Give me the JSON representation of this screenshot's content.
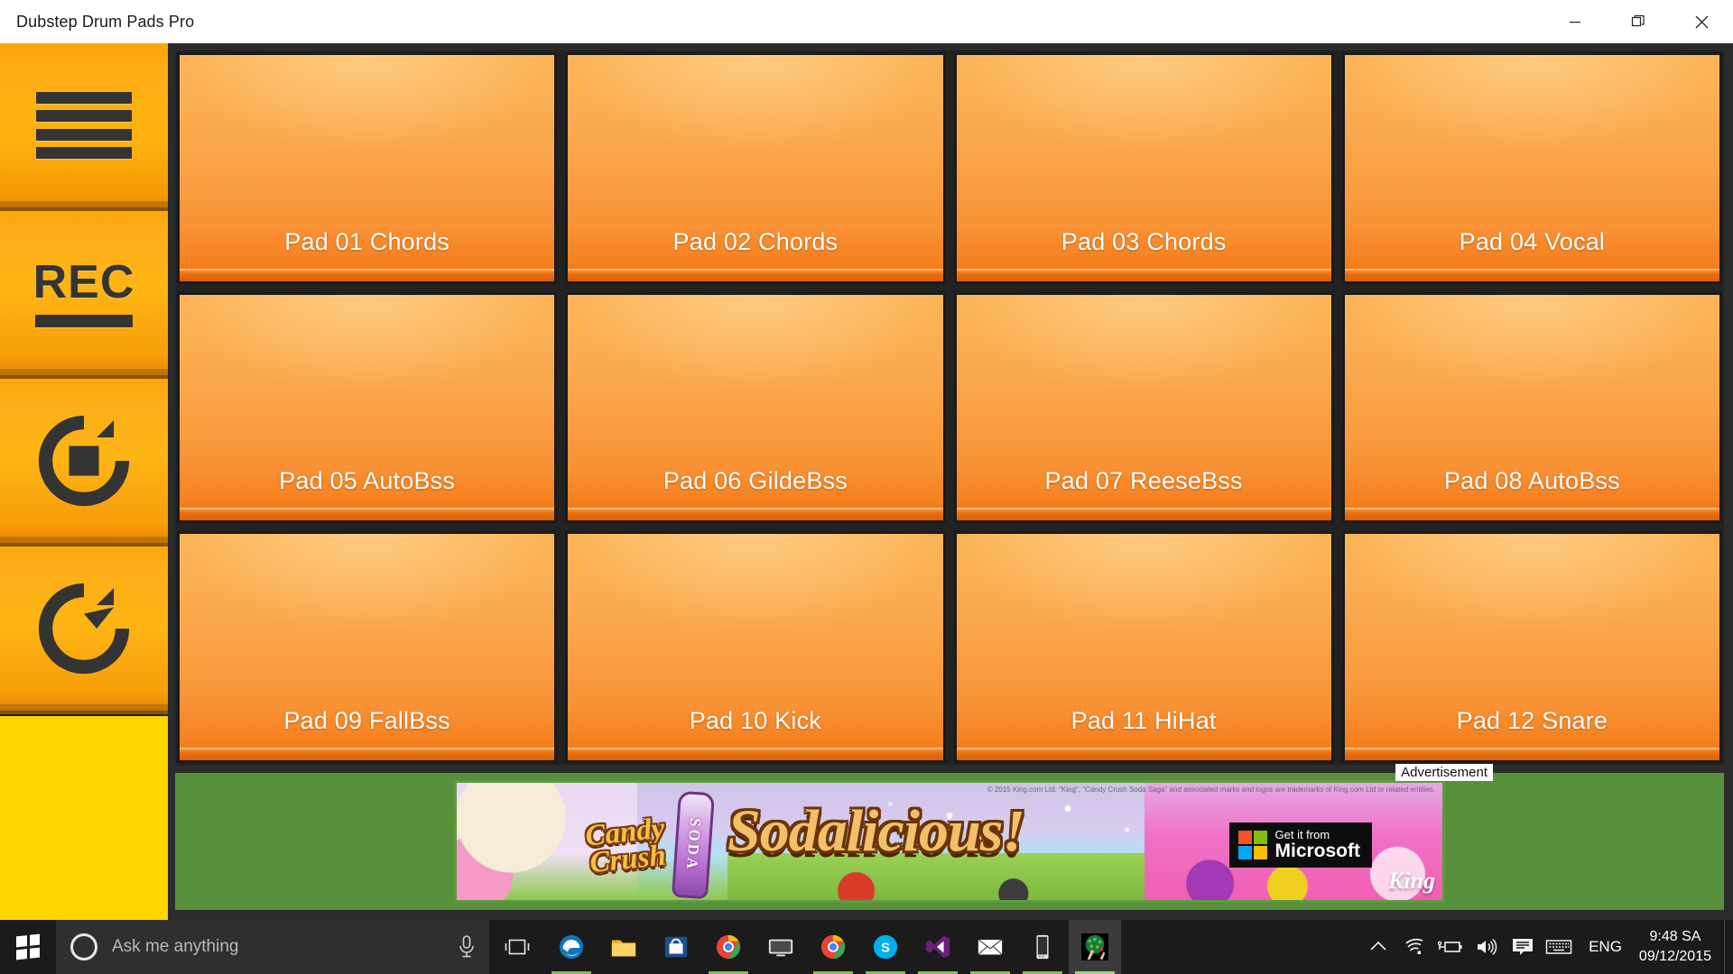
{
  "window": {
    "title": "Dubstep Drum Pads Pro",
    "controls": {
      "minimize": "Minimize",
      "maximize": "Restore",
      "close": "Close"
    }
  },
  "sidebar": {
    "buttons": [
      {
        "name": "menu",
        "icon": "hamburger-menu-icon",
        "label": ""
      },
      {
        "name": "record",
        "icon": "rec-icon",
        "label": "REC"
      },
      {
        "name": "loop-stop",
        "icon": "loop-stop-icon",
        "label": ""
      },
      {
        "name": "loop-replay",
        "icon": "loop-replay-icon",
        "label": ""
      }
    ]
  },
  "pads": [
    {
      "id": 1,
      "label": "Pad 01 Chords"
    },
    {
      "id": 2,
      "label": "Pad 02 Chords"
    },
    {
      "id": 3,
      "label": "Pad 03 Chords"
    },
    {
      "id": 4,
      "label": "Pad 04 Vocal"
    },
    {
      "id": 5,
      "label": "Pad 05 AutoBss"
    },
    {
      "id": 6,
      "label": "Pad 06 GildeBss"
    },
    {
      "id": 7,
      "label": "Pad 07 ReeseBss"
    },
    {
      "id": 8,
      "label": "Pad 08 AutoBss"
    },
    {
      "id": 9,
      "label": "Pad 09 FallBss"
    },
    {
      "id": 10,
      "label": "Pad 10 Kick"
    },
    {
      "id": 11,
      "label": "Pad 11 HiHat"
    },
    {
      "id": 12,
      "label": "Pad 12 Snare"
    }
  ],
  "ad": {
    "label": "Advertisement",
    "brand_line1": "Candy",
    "brand_line2": "Crush",
    "soda_word": "SODA",
    "title": "Sodalicious!",
    "copyright": "© 2015 King.com Ltd. \"King\", \"Candy Crush Soda Saga\" and associated marks and logos are trademarks of King.com Ltd or related entities.",
    "store_badge_small": "Get it from",
    "store_badge_big": "Microsoft",
    "king_logo": "King"
  },
  "taskbar": {
    "start": "Start",
    "search_placeholder": "Ask me anything",
    "mic": "microphone-icon",
    "task_view": "task-view-icon",
    "apps": [
      {
        "name": "edge",
        "icon": "edge-icon",
        "running": true,
        "active": false
      },
      {
        "name": "file-explorer",
        "icon": "folder-icon",
        "running": false,
        "active": false
      },
      {
        "name": "store",
        "icon": "store-icon",
        "running": false,
        "active": false
      },
      {
        "name": "chrome",
        "icon": "chrome-icon",
        "running": true,
        "active": false
      },
      {
        "name": "remote-desktop",
        "icon": "monitor-icon",
        "running": false,
        "active": false
      },
      {
        "name": "chrome-2",
        "icon": "chrome-icon",
        "running": true,
        "active": false
      },
      {
        "name": "skype",
        "icon": "skype-icon",
        "running": true,
        "active": false
      },
      {
        "name": "visual-studio",
        "icon": "visual-studio-icon",
        "running": true,
        "active": false
      },
      {
        "name": "mail",
        "icon": "mail-icon",
        "running": true,
        "active": false
      },
      {
        "name": "phone",
        "icon": "phone-icon",
        "running": true,
        "active": false
      },
      {
        "name": "drum-pads",
        "icon": "drum-pads-app-icon",
        "running": true,
        "active": true
      }
    ],
    "tray": {
      "show_hidden": "chevron-up-icon",
      "network": "wifi-icon",
      "battery": "battery-charging-icon",
      "volume": "speaker-icon",
      "action_center": "action-center-icon",
      "keyboard": "touch-keyboard-icon",
      "language": "ENG",
      "time": "9:48 SA",
      "date": "09/12/2015"
    }
  },
  "colors": {
    "accent_orange": "#FDB215",
    "sidebar_yellow": "#FFD400",
    "pad_top": "#FBB457",
    "pad_bottom": "#EE7410",
    "app_bg": "#2b2b2b",
    "ad_bg": "#56903a",
    "taskbar": "#1b1b1b",
    "running_underline": "#7fbf4d"
  }
}
